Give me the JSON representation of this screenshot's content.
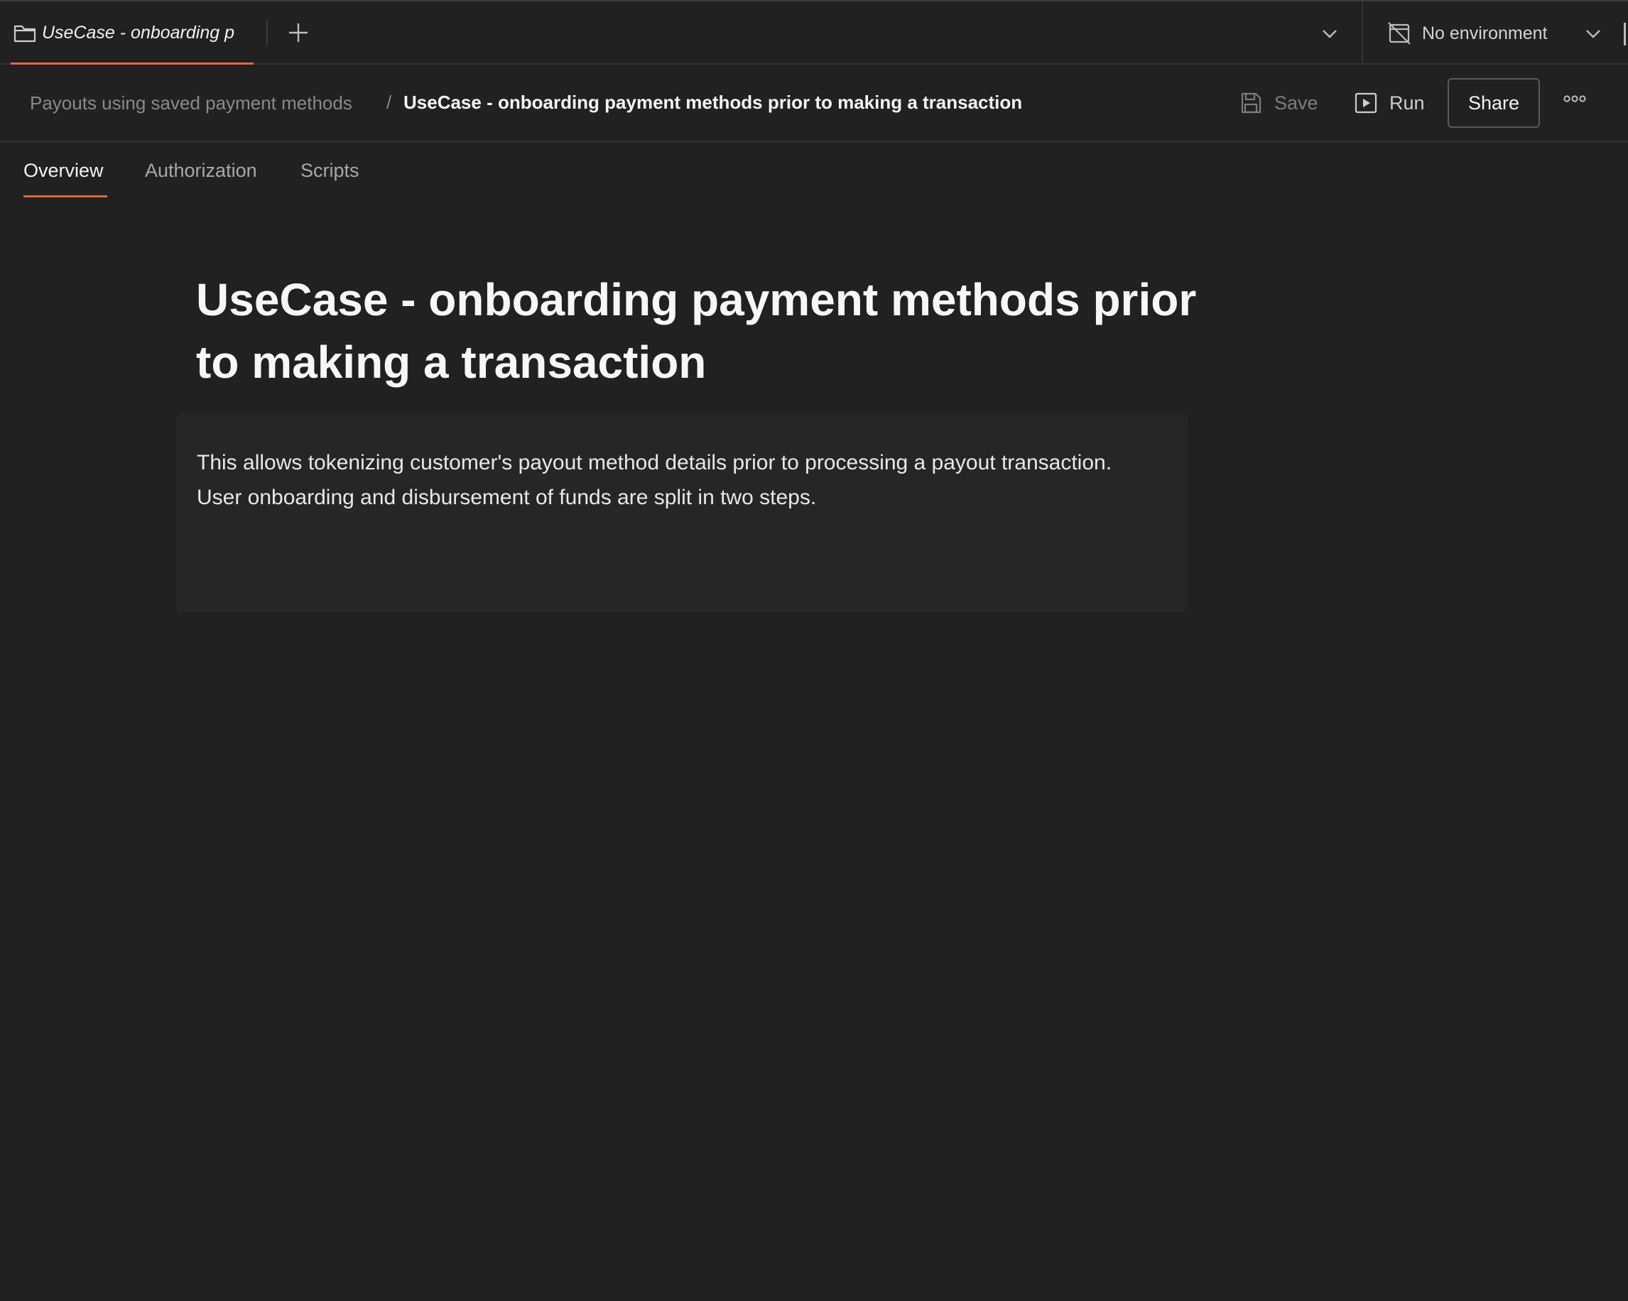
{
  "tabbar": {
    "active_tab_title": "UseCase - onboarding p",
    "environment_label": "No environment"
  },
  "header": {
    "breadcrumb_parent": "Payouts using saved payment methods",
    "breadcrumb_separator": "/",
    "breadcrumb_current": "UseCase - onboarding payment methods prior to making a transaction",
    "save_label": "Save",
    "run_label": "Run",
    "share_label": "Share"
  },
  "subtabs": [
    {
      "label": "Overview",
      "active": true
    },
    {
      "label": "Authorization",
      "active": false
    },
    {
      "label": "Scripts",
      "active": false
    }
  ],
  "main": {
    "title": "UseCase - onboarding payment methods prior to making a transaction",
    "description": "This allows tokenizing customer's payout method details prior to processing a payout transaction. User onboarding and disbursement of funds are split in two steps."
  },
  "colors": {
    "background": "#212121",
    "accent": "#e0693a",
    "description_box": "#262626"
  },
  "icons": {
    "tab": "folder-icon",
    "new_tab": "plus-icon",
    "tabs_menu": "chevron-down-icon",
    "environment": "no-environment-icon",
    "save": "save-icon",
    "run": "run-icon",
    "more": "more-options-icon"
  }
}
